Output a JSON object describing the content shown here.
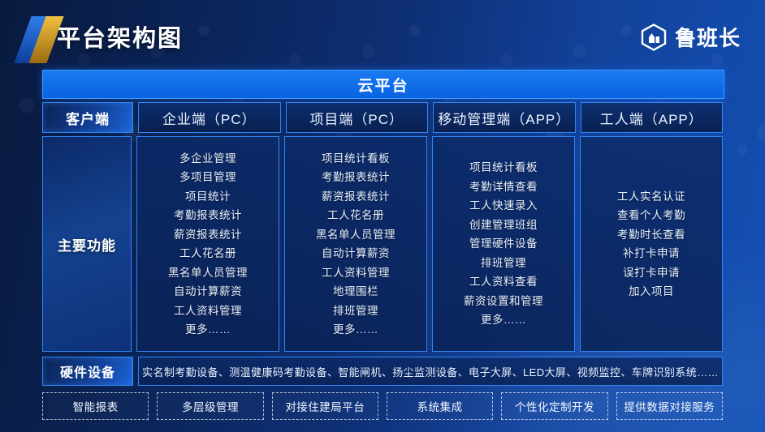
{
  "header": {
    "title": "平台架构图",
    "brand_name": "鲁班长",
    "logo_icon": "hexagon-building-icon",
    "decor_icon": "slanted-bars-icon"
  },
  "cloud_banner": {
    "label": "云平台"
  },
  "row_headers": {
    "client_label": "客户端",
    "columns": [
      "企业端（PC）",
      "项目端（PC）",
      "移动管理端（APP）",
      "工人端（APP）"
    ]
  },
  "main_functions": {
    "label": "主要功能",
    "columns": [
      {
        "name": "企业端（PC）",
        "items": [
          "多企业管理",
          "多项目管理",
          "项目统计",
          "考勤报表统计",
          "薪资报表统计",
          "工人花名册",
          "黑名单人员管理",
          "自动计算薪资",
          "工人资料管理",
          "更多……"
        ]
      },
      {
        "name": "项目端（PC）",
        "items": [
          "项目统计看板",
          "考勤报表统计",
          "薪资报表统计",
          "工人花名册",
          "黑名单人员管理",
          "自动计算薪资",
          "工人资料管理",
          "地理围栏",
          "排班管理",
          "更多……"
        ]
      },
      {
        "name": "移动管理端（APP）",
        "items": [
          "项目统计看板",
          "考勤详情查看",
          "工人快速录入",
          "创建管理班组",
          "管理硬件设备",
          "排班管理",
          "工人资料查看",
          "薪资设置和管理",
          "更多……"
        ]
      },
      {
        "name": "工人端（APP）",
        "items": [
          "工人实名认证",
          "查看个人考勤",
          "考勤时长查看",
          "补打卡申请",
          "误打卡申请",
          "加入项目"
        ]
      }
    ]
  },
  "hardware": {
    "label": "硬件设备",
    "list": "实名制考勤设备、测温健康码考勤设备、智能闸机、扬尘监测设备、电子大屏、LED大屏、视频监控、车牌识别系统……"
  },
  "footer_tags": [
    "智能报表",
    "多层级管理",
    "对接住建局平台",
    "系统集成",
    "个性化定制开发",
    "提供数据对接服务"
  ],
  "colors": {
    "accent_blue": "#0a63e0",
    "border_blue": "#2f86f5",
    "bg_dark": "#081a3e",
    "bg_light": "#1450b4",
    "gold": "#f0c040"
  }
}
